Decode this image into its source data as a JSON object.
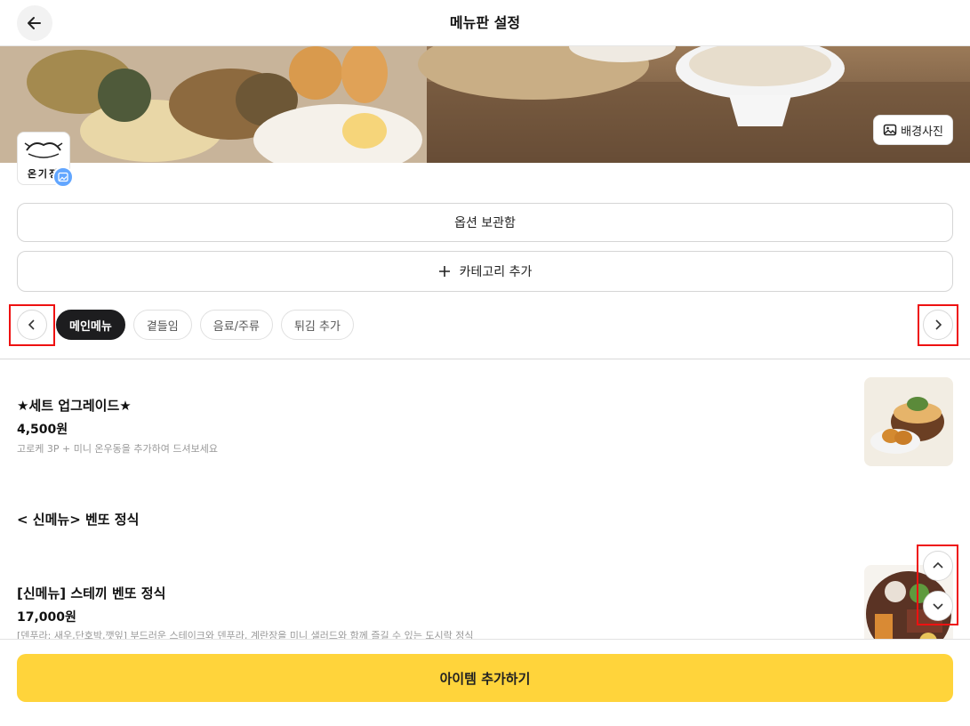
{
  "header": {
    "title": "메뉴판 설정",
    "back_icon": "arrow-left-icon"
  },
  "banner": {
    "bg_photo_label": "배경사진",
    "bg_photo_icon": "image-icon"
  },
  "logo": {
    "text": "온기정",
    "edit_icon": "image-edit-icon"
  },
  "actions": {
    "options_storage": "옵션 보관함",
    "add_category": "카테고리 추가",
    "add_icon": "plus-icon"
  },
  "tabs": {
    "items": [
      {
        "label": "메인메뉴",
        "active": true
      },
      {
        "label": "곁들임",
        "active": false
      },
      {
        "label": "음료/주류",
        "active": false
      },
      {
        "label": "튀김 추가",
        "active": false
      }
    ],
    "prev_icon": "chevron-left-icon",
    "next_icon": "chevron-right-icon"
  },
  "menu": {
    "items": [
      {
        "name": "★세트 업그레이드★",
        "price": "4,500원",
        "description": "고로케 3P + 미니 온우동을 추가하여 드셔보세요"
      },
      {
        "name": "[신메뉴] 스테끼 벤또 정식",
        "price": "17,000원",
        "description": "[덴푸라: 새우,단호박,깻잎] 부드러운 스테이크와 덴푸라, 계란장을 미니 샐러드와 함께 즐길 수 있는 도시락 정식"
      }
    ],
    "section_title": "< 신메뉴> 벤또 정식",
    "scroll_up_icon": "chevron-up-icon",
    "scroll_down_icon": "chevron-down-icon"
  },
  "footer": {
    "add_item_label": "아이템 추가하기"
  },
  "colors": {
    "accent_yellow": "#ffd43b",
    "active_chip": "#1d1d1f",
    "highlight_red": "#e11111",
    "logo_edit_blue": "#62a6ff"
  }
}
